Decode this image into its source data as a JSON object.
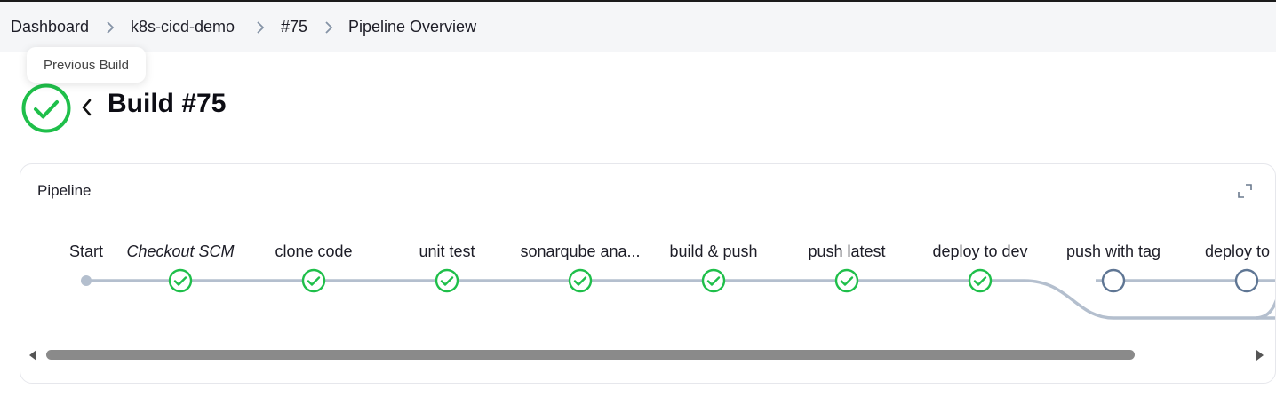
{
  "breadcrumb": {
    "items": [
      "Dashboard",
      "k8s-cicd-demo",
      "#75",
      "Pipeline Overview"
    ]
  },
  "tooltip": {
    "text": "Previous Build"
  },
  "build": {
    "title": "Build #75",
    "status": "success",
    "status_icon": "check-circle-icon",
    "prev_icon": "chevron-left-icon"
  },
  "pipeline": {
    "title": "Pipeline",
    "expand_icon": "expand-icon",
    "stages": [
      {
        "label": "Start",
        "status": "start",
        "italic": false
      },
      {
        "label": "Checkout SCM",
        "status": "success",
        "italic": true
      },
      {
        "label": "clone code",
        "status": "success",
        "italic": false
      },
      {
        "label": "unit test",
        "status": "success",
        "italic": false
      },
      {
        "label": "sonarqube ana...",
        "status": "success",
        "italic": false
      },
      {
        "label": "build & push",
        "status": "success",
        "italic": false
      },
      {
        "label": "push latest",
        "status": "success",
        "italic": false
      },
      {
        "label": "deploy to dev",
        "status": "success",
        "italic": false
      },
      {
        "label": "push with tag",
        "status": "not-built",
        "italic": false
      },
      {
        "label": "deploy to pr",
        "status": "not-built",
        "italic": false
      }
    ]
  },
  "colors": {
    "success": "#1fbf4a",
    "not_built": "#5f7694",
    "edge": "#b4bfce",
    "breadcrumb_bg": "#f5f6f8",
    "scroll_thumb": "#8a8a8a"
  }
}
